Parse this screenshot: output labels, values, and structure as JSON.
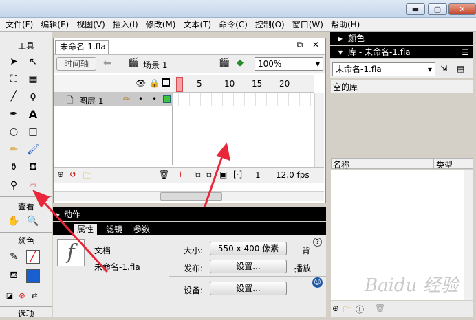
{
  "titlebar": {
    "min": "▬",
    "max": "▢",
    "close": "✕"
  },
  "menu": [
    "文件(F)",
    "编辑(E)",
    "视图(V)",
    "插入(I)",
    "修改(M)",
    "文本(T)",
    "命令(C)",
    "控制(O)",
    "窗口(W)",
    "帮助(H)"
  ],
  "tools": {
    "title": "工具",
    "view_title": "查看",
    "color_title": "颜色",
    "options_title": "选项"
  },
  "document": {
    "tab": "未命名-1.fla",
    "timeline_btn": "时间轴",
    "scene": "场景 1",
    "zoom": "100%",
    "layer_name": "图层 1",
    "ruler_ticks": [
      "5",
      "10",
      "15",
      "20"
    ],
    "frame_number": "1",
    "fps": "12.0 fps"
  },
  "panels": {
    "actions": "动作",
    "prop_tabs": [
      "属性",
      "滤镜",
      "参数"
    ],
    "doc_label": "文档",
    "doc_name": "未命名-1.fla",
    "size_label": "大小:",
    "size_value": "550 x 400 像素",
    "publish_label": "发布:",
    "publish_btn": "设置...",
    "device_label": "设备:",
    "device_btn": "设置...",
    "bg_label": "背",
    "play_label": "播放",
    "help": "?"
  },
  "library": {
    "color_header": "颜色",
    "lib_header": "库 - 未命名-1.fla",
    "selector": "未命名-1.fla",
    "empty": "空的库",
    "col_name": "名称",
    "col_type": "类型"
  },
  "watermark": "Baidu 经验"
}
